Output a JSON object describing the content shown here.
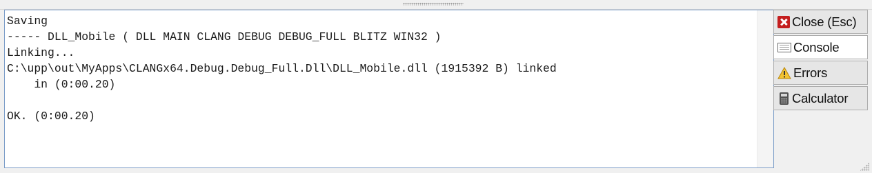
{
  "console": {
    "lines": [
      "Saving",
      "----- DLL_Mobile ( DLL MAIN CLANG DEBUG DEBUG_FULL BLITZ WIN32 )",
      "Linking...",
      "C:\\upp\\out\\MyApps\\CLANGx64.Debug.Debug_Full.Dll\\DLL_Mobile.dll (1915392 B) linked",
      "    in (0:00.20)",
      "",
      "OK. (0:00.20)"
    ]
  },
  "buttons": {
    "close": {
      "label": "Close (Esc)",
      "icon": "close-icon"
    },
    "console": {
      "label": "Console",
      "icon": "console-icon",
      "active": true
    },
    "errors": {
      "label": "Errors",
      "icon": "warning-icon"
    },
    "calculator": {
      "label": "Calculator",
      "icon": "calculator-icon"
    }
  },
  "colors": {
    "close_icon": "#c41e1e",
    "warning_icon": "#f2c230",
    "console_border": "#7a9cc8"
  }
}
